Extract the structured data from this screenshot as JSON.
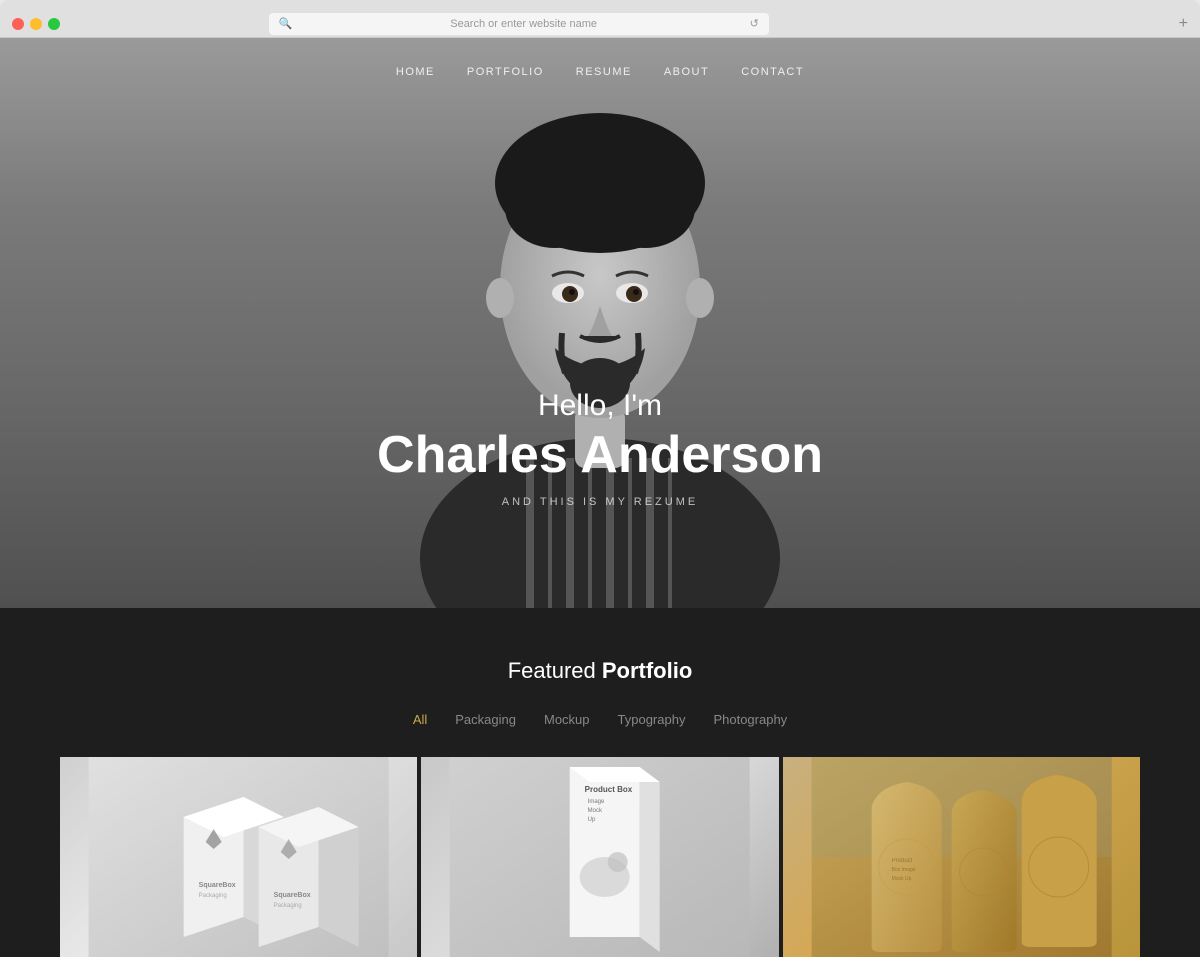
{
  "browser": {
    "address_placeholder": "Search or enter website name",
    "new_tab_label": "+"
  },
  "nav": {
    "items": [
      {
        "id": "home",
        "label": "HOME"
      },
      {
        "id": "portfolio",
        "label": "PORTFOLIO"
      },
      {
        "id": "resume",
        "label": "RESUME"
      },
      {
        "id": "about",
        "label": "ABOUT"
      },
      {
        "id": "contact",
        "label": "CONTACT"
      }
    ]
  },
  "hero": {
    "greeting": "Hello, I'm",
    "name": "Charles Anderson",
    "subtitle": "AND THIS IS MY REZUME"
  },
  "portfolio": {
    "title_prefix": "Featured ",
    "title_bold": "Portfolio",
    "filters": [
      {
        "id": "all",
        "label": "All",
        "active": true
      },
      {
        "id": "packaging",
        "label": "Packaging",
        "active": false
      },
      {
        "id": "mockup",
        "label": "Mockup",
        "active": false
      },
      {
        "id": "typography",
        "label": "Typography",
        "active": false
      },
      {
        "id": "photography",
        "label": "Photography",
        "active": false
      }
    ]
  },
  "colors": {
    "accent": "#c9a84c",
    "nav_bg": "transparent",
    "hero_bg": "#808080",
    "portfolio_bg": "#1e1e1e"
  }
}
